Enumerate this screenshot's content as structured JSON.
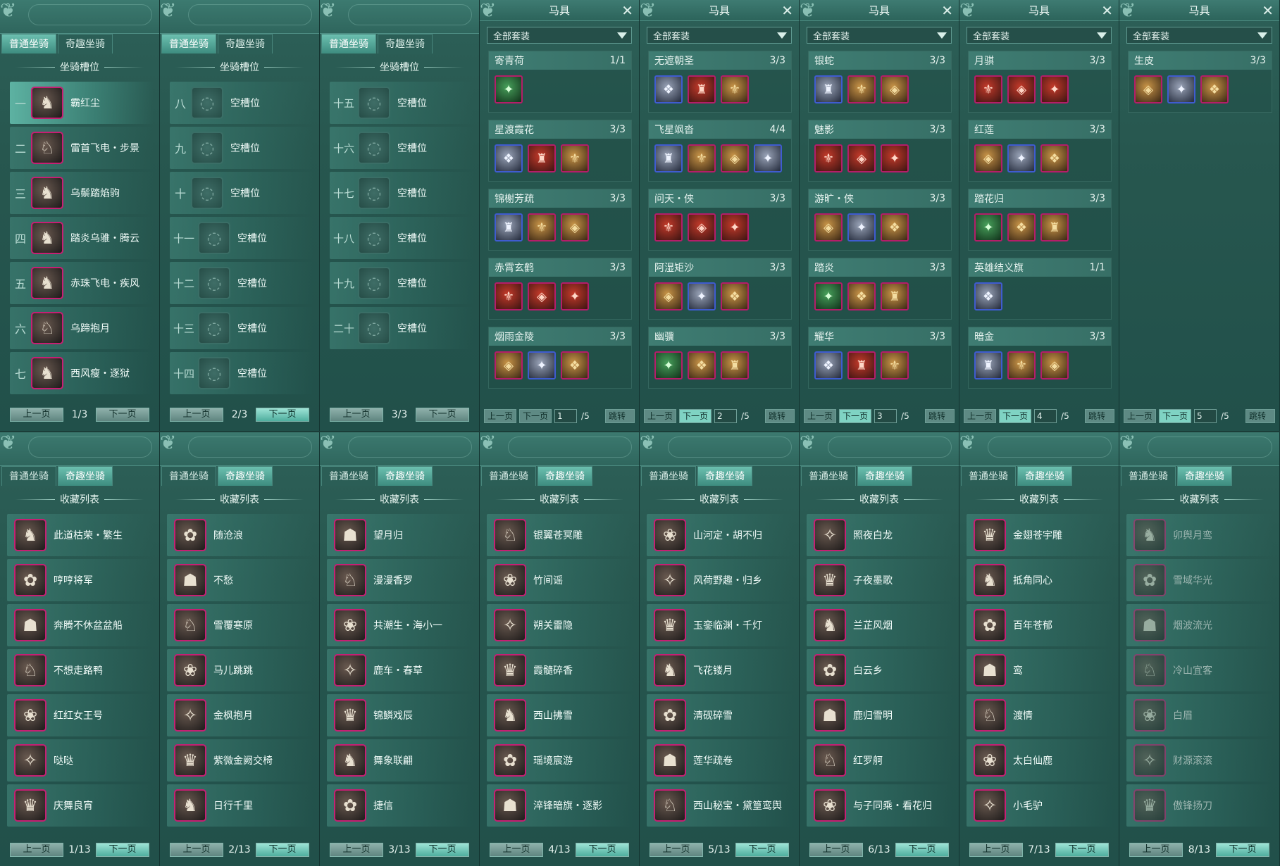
{
  "tabs": {
    "normal": "普通坐骑",
    "fun": "奇趣坐骑"
  },
  "slots": {
    "section": "坐骑槽位",
    "empty_label": "空槽位",
    "pages": [
      {
        "page": "1/3",
        "rows": [
          {
            "num": "一",
            "name": "霸红尘"
          },
          {
            "num": "二",
            "name": "雷首飞电・步景"
          },
          {
            "num": "三",
            "name": "乌鬃踏焰驹"
          },
          {
            "num": "四",
            "name": "踏炎乌骓・腾云"
          },
          {
            "num": "五",
            "name": "赤珠飞电・疾风"
          },
          {
            "num": "六",
            "name": "乌蹄抱月"
          },
          {
            "num": "七",
            "name": "西风瘦・逐狱"
          }
        ]
      },
      {
        "page": "2/3",
        "rows": [
          {
            "num": "八",
            "name": "空槽位"
          },
          {
            "num": "九",
            "name": "空槽位"
          },
          {
            "num": "十",
            "name": "空槽位"
          },
          {
            "num": "十一",
            "name": "空槽位"
          },
          {
            "num": "十二",
            "name": "空槽位"
          },
          {
            "num": "十三",
            "name": "空槽位"
          },
          {
            "num": "十四",
            "name": "空槽位"
          }
        ]
      },
      {
        "page": "3/3",
        "rows": [
          {
            "num": "十五",
            "name": "空槽位"
          },
          {
            "num": "十六",
            "name": "空槽位"
          },
          {
            "num": "十七",
            "name": "空槽位"
          },
          {
            "num": "十八",
            "name": "空槽位"
          },
          {
            "num": "十九",
            "name": "空槽位"
          },
          {
            "num": "二十",
            "name": "空槽位"
          }
        ]
      }
    ]
  },
  "pager": {
    "prev": "上一页",
    "next": "下一页",
    "jump": "跳转"
  },
  "equip": {
    "title": "马具",
    "filter": "全部套装",
    "total": "/5",
    "pages": [
      {
        "page": "1",
        "sets": [
          {
            "name": "寄青荷",
            "count": "1/1"
          },
          {
            "name": "星渡霞花",
            "count": "3/3"
          },
          {
            "name": "锦榭芳疏",
            "count": "3/3"
          },
          {
            "name": "赤霄玄鹤",
            "count": "3/3"
          },
          {
            "name": "烟雨金陵",
            "count": "3/3"
          }
        ]
      },
      {
        "page": "2",
        "sets": [
          {
            "name": "无遮朝圣",
            "count": "3/3"
          },
          {
            "name": "飞星飒沓",
            "count": "4/4"
          },
          {
            "name": "问天・侠",
            "count": "3/3"
          },
          {
            "name": "阿湿矩沙",
            "count": "3/3"
          },
          {
            "name": "幽骥",
            "count": "3/3"
          }
        ]
      },
      {
        "page": "3",
        "sets": [
          {
            "name": "银蛇",
            "count": "3/3"
          },
          {
            "name": "魅影",
            "count": "3/3"
          },
          {
            "name": "游旷・侠",
            "count": "3/3"
          },
          {
            "name": "踏炎",
            "count": "3/3"
          },
          {
            "name": "耀华",
            "count": "3/3"
          }
        ]
      },
      {
        "page": "4",
        "sets": [
          {
            "name": "月骐",
            "count": "3/3"
          },
          {
            "name": "红莲",
            "count": "3/3"
          },
          {
            "name": "踏花归",
            "count": "3/3"
          },
          {
            "name": "英雄结义旗",
            "count": "1/1"
          },
          {
            "name": "暗金",
            "count": "3/3"
          }
        ]
      },
      {
        "page": "5",
        "sets": [
          {
            "name": "生皮",
            "count": "3/3"
          }
        ]
      }
    ]
  },
  "collection": {
    "section": "收藏列表",
    "pages": [
      {
        "page": "1/13",
        "items": [
          "此道枯荣・繁生",
          "哼哼将军",
          "奔腾不休盆盆船",
          "不想走路鸭",
          "红红女王号",
          "哒哒",
          "庆舞良宵"
        ]
      },
      {
        "page": "2/13",
        "items": [
          "随沧浪",
          "不愁",
          "雪覆寒原",
          "马儿跳跳",
          "金枫抱月",
          "紫微金阙交椅",
          "日行千里"
        ]
      },
      {
        "page": "3/13",
        "items": [
          "望月归",
          "漫漫香罗",
          "共潮生・海小一",
          "鹿车・春草",
          "锦鳞戏辰",
          "舞象联翩",
          "捷信"
        ]
      },
      {
        "page": "4/13",
        "items": [
          "银翼苍冥雕",
          "竹间谣",
          "朔关雷隐",
          "霞髓碎香",
          "西山拂雪",
          "瑶境宸游",
          "淬锋暗旗・逐影"
        ]
      },
      {
        "page": "5/13",
        "items": [
          "山河定・胡不归",
          "风荷野趣・归乡",
          "玉銮临渊・千灯",
          "飞花镂月",
          "清砚碎雪",
          "莲华疏卷",
          "西山秘宝・黛篁鸾舆"
        ]
      },
      {
        "page": "6/13",
        "items": [
          "照夜白龙",
          "子夜墨歌",
          "兰芷风烟",
          "白云乡",
          "鹿归雪明",
          "红罗舸",
          "与子同乘・看花归"
        ]
      },
      {
        "page": "7/13",
        "items": [
          "金翅苍宇雕",
          "抵角同心",
          "百年苍郁",
          "鸾",
          "渡情",
          "太白仙鹿",
          "小毛驴"
        ]
      },
      {
        "page": "8/13",
        "items": [
          "卯舆月鸾",
          "雪域华光",
          "烟波流光",
          "冷山宜客",
          "白眉",
          "财源滚滚",
          "傲锋扬刀"
        ]
      }
    ]
  }
}
